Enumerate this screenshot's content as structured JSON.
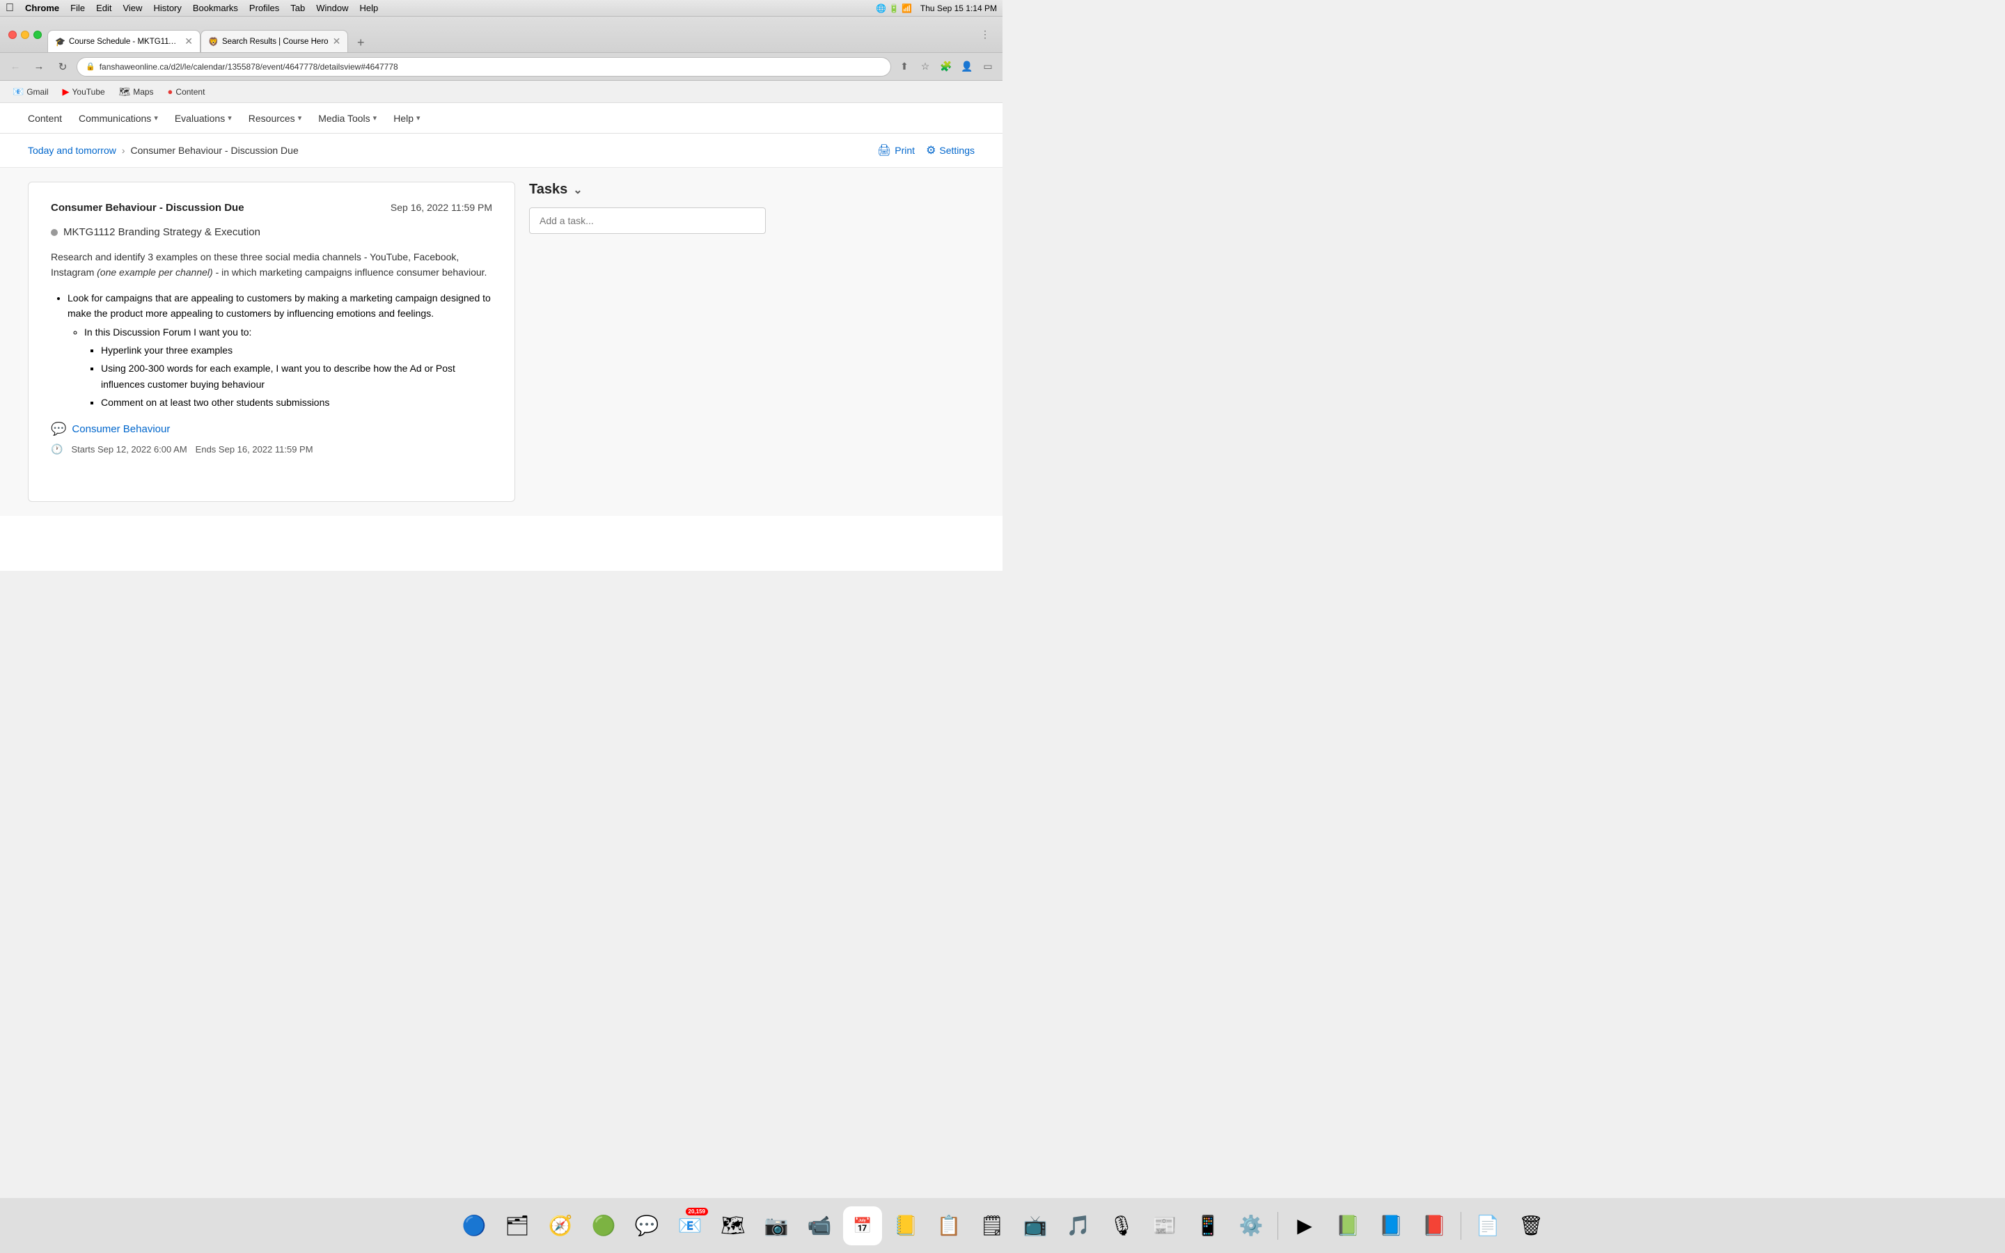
{
  "menubar": {
    "apple": "⌘",
    "app": "Chrome",
    "items": [
      "File",
      "Edit",
      "View",
      "History",
      "Bookmarks",
      "Profiles",
      "Tab",
      "Window",
      "Help"
    ],
    "datetime": "Thu Sep 15  1:14 PM"
  },
  "browser": {
    "tabs": [
      {
        "id": "tab1",
        "favicon": "🎓",
        "title": "Course Schedule - MKTG1112...",
        "active": true,
        "url": "fanshaweonline.ca/d2l/le/calendar/1355878/event/4647778/detailsview#4647778"
      },
      {
        "id": "tab2",
        "favicon": "🦁",
        "title": "Search Results | Course Hero",
        "active": false
      }
    ],
    "url": "fanshaweonline.ca/d2l/le/calendar/1355878/event/4647778/detailsview#4647778"
  },
  "bookmarks": [
    {
      "icon": "📧",
      "label": "Gmail"
    },
    {
      "icon": "▶",
      "label": "YouTube"
    },
    {
      "icon": "🗺",
      "label": "Maps"
    },
    {
      "icon": "📄",
      "label": "Content"
    }
  ],
  "nav": {
    "items": [
      {
        "label": "Content",
        "hasArrow": false
      },
      {
        "label": "Communications",
        "hasArrow": true
      },
      {
        "label": "Evaluations",
        "hasArrow": true
      },
      {
        "label": "Resources",
        "hasArrow": true
      },
      {
        "label": "Media Tools",
        "hasArrow": true
      },
      {
        "label": "Help",
        "hasArrow": true
      }
    ]
  },
  "breadcrumb": {
    "parent": "Today and tomorrow",
    "current": "Consumer Behaviour - Discussion Due",
    "actions": {
      "print": "Print",
      "settings": "Settings"
    }
  },
  "assignment": {
    "title": "Consumer Behaviour - Discussion Due",
    "date": "Sep 16, 2022 11:59 PM",
    "course": "MKTG1112 Branding Strategy & Execution",
    "body_intro": "Research and identify 3 examples on these three social media channels - YouTube, Facebook, Instagram ",
    "body_italic": "(one example per channel)",
    "body_end": " - in which marketing campaigns influence consumer behaviour.",
    "bullets": [
      {
        "text": "Look for campaigns that are appealing to customers by making a marketing campaign designed to make the product more appealing to customers by influencing emotions and feelings.",
        "subItems": [
          {
            "text": "In this Discussion Forum I want you to:",
            "squareItems": [
              "Hyperlink your three examples",
              "Using 200-300 words for each example, I want you to describe how the Ad or Post influences customer buying behaviour",
              "Comment on at least two other students submissions"
            ]
          }
        ]
      }
    ],
    "forum_link": "Consumer Behaviour",
    "starts": "Starts Sep 12, 2022 6:00 AM",
    "ends": "Ends Sep 16, 2022 11:59 PM"
  },
  "tasks": {
    "header": "Tasks",
    "placeholder": "Add a task..."
  },
  "dock": {
    "items": [
      {
        "icon": "🔵",
        "label": "Finder",
        "badge": null
      },
      {
        "icon": "🗂",
        "label": "Launchpad",
        "badge": null
      },
      {
        "icon": "🧭",
        "label": "Safari",
        "badge": null
      },
      {
        "icon": "🟢",
        "label": "Chrome",
        "badge": null
      },
      {
        "icon": "💬",
        "label": "Messages",
        "badge": null
      },
      {
        "icon": "📧",
        "label": "Mail",
        "badge": "20,159"
      },
      {
        "icon": "🗺",
        "label": "Maps",
        "badge": null
      },
      {
        "icon": "📷",
        "label": "Photos",
        "badge": null
      },
      {
        "icon": "📹",
        "label": "Facetime",
        "badge": null
      },
      {
        "icon": "📅",
        "label": "Calendar",
        "badge": null
      },
      {
        "icon": "📒",
        "label": "Contacts",
        "badge": null
      },
      {
        "icon": "📋",
        "label": "Reminders",
        "badge": null
      },
      {
        "icon": "🗒",
        "label": "Notes",
        "badge": null
      },
      {
        "icon": "📺",
        "label": "Apple TV",
        "badge": null
      },
      {
        "icon": "🎵",
        "label": "Music",
        "badge": null
      },
      {
        "icon": "🎙",
        "label": "Podcasts",
        "badge": null
      },
      {
        "icon": "📰",
        "label": "News",
        "badge": null
      },
      {
        "icon": "📱",
        "label": "App Store",
        "badge": null
      },
      {
        "icon": "⚙️",
        "label": "System Prefs",
        "badge": null
      },
      {
        "icon": "▶",
        "label": "GameStream",
        "badge": null
      },
      {
        "icon": "📗",
        "label": "Excel",
        "badge": null
      },
      {
        "icon": "📘",
        "label": "Word",
        "badge": null
      },
      {
        "icon": "📕",
        "label": "PowerPoint",
        "badge": null
      },
      {
        "icon": "📄",
        "label": "Preview",
        "badge": null
      },
      {
        "icon": "🗑",
        "label": "Trash",
        "badge": null
      }
    ]
  }
}
